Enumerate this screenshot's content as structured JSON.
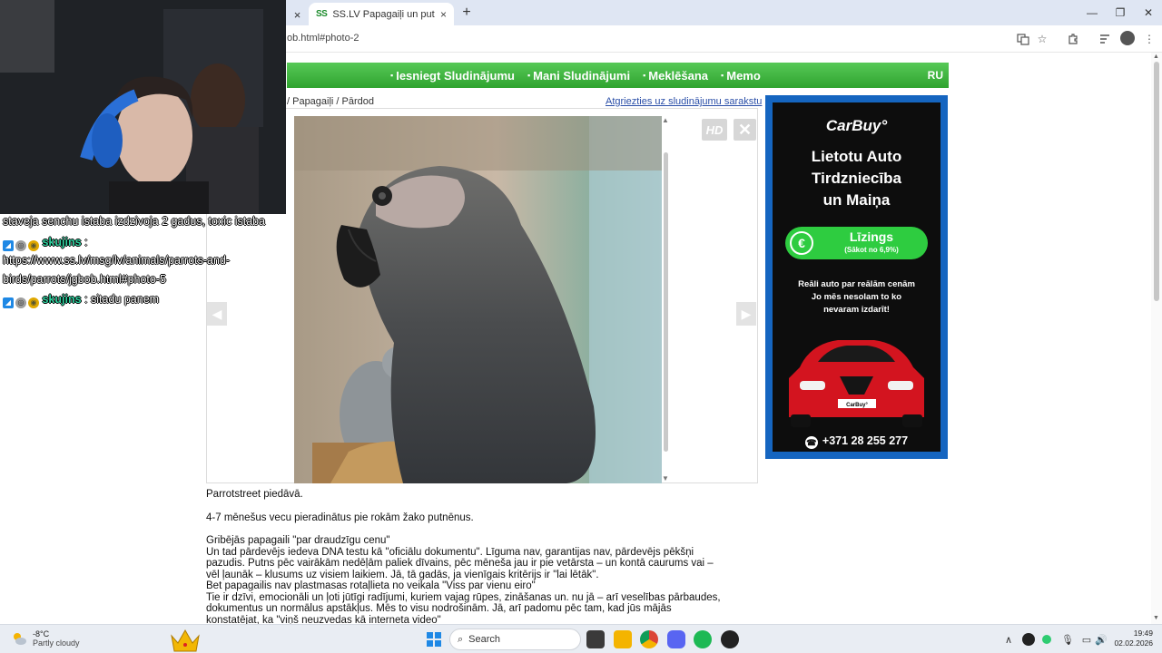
{
  "browser": {
    "prev_tab_close": "×",
    "active_tab": {
      "favicon": "SS",
      "title": "SS.LV Papagaiļi un putni - Papagaiļi",
      "close": "×"
    },
    "new_tab": "+",
    "url": "ob.html#photo-2",
    "window_controls": {
      "minimize": "—",
      "maximize": "❐",
      "close": "✕"
    }
  },
  "navbar": {
    "items": [
      "Iesniegt Sludinājumu",
      "Mani Sludinājumi",
      "Meklēšana",
      "Memo"
    ],
    "language": "RU"
  },
  "breadcrumbs": "/ Papagaiļi / Pārdod",
  "back_link": "Atgriezties uz sludinājumu sarakstu",
  "gallery": {
    "hd_label": "HD",
    "close_label": "✕",
    "prev_arrow": "◀",
    "next_arrow": "▶"
  },
  "ad": {
    "brand": "CarBuy°",
    "headline": [
      "Lietotu Auto",
      "Tirdzniecība",
      "un Maiņa"
    ],
    "pill_title": "Līzings",
    "pill_subtitle": "(Sākot no 6,9%)",
    "copy": "Reāli auto par reālām cenām\nJo mēs nesolam to ko\nnevaram izdarīt!",
    "car_plate": "CarBuy°",
    "phone": "+371 28 255 277",
    "colors": {
      "frame": "#1565c0",
      "background": "#0d0d0d",
      "accent": "#2ecc40",
      "car": "#d3141f"
    }
  },
  "description": {
    "p1": "Parrotstreet piedāvā.",
    "p2": "4-7 mēnešus vecu pieradinātus pie rokām žako putnēnus.",
    "p3_lines": [
      "Gribējās papagaili \"par draudzīgu cenu\"",
      "Un tad pārdevējs iedeva DNA testu kā \"oficiālu dokumentu\". Līguma nav, garantijas nav, pārdevējs pēkšņi",
      "pazudis. Putns pēc vairākām nedēļām paliek dīvains, pēc mēneša jau ir pie vetārsta – un kontā caurums vai –",
      "vēl ļaunāk – klusums uz visiem laikiem. Jā, tā gadās, ja vienīgais kritērijs ir \"lai lētāk\".",
      "Bet papagailis nav plastmasas rotaļlieta no veikala \"Viss par vienu eiro\"",
      "Tie ir dzīvi, emocionāli un ļoti jūtīgi radījumi, kuriem vajag rūpes, zināšanas un. nu jā – arī veselības pārbaudes,",
      "dokumentus un normālus apstākļus. Mēs to visu nodrošinām. Jā, arī padomu pēc tam, kad jūs mājās",
      "konstatējat, ka \"viņš neuzvedas kā interneta video\""
    ]
  },
  "chat": {
    "messages": [
      {
        "user": "",
        "text": "staveja senchu istaba izdzivoja 2 gadus, toxic istaba"
      },
      {
        "user": "skujins",
        "text": "https://www.ss.lv/msg/lv/animals/parrots-and-birds/parrots/jgbob.html#photo-5",
        "separator": ":"
      },
      {
        "user": "skujins",
        "text": "sitadu panem",
        "separator": ":"
      }
    ]
  },
  "taskbar": {
    "weather": {
      "temp": "-8°C",
      "condition": "Partly cloudy"
    },
    "search_placeholder": "Search",
    "tray_chevron": "∧",
    "time": "19:49",
    "date": "02.02.2026"
  }
}
